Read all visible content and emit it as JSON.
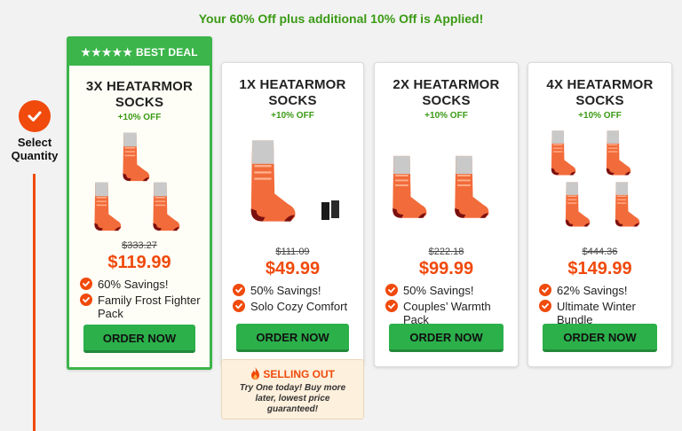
{
  "banner": "Your 60% Off plus additional 10% Off is Applied!",
  "step": {
    "label": "Select Quantity"
  },
  "colors": {
    "accent": "#f04a0c",
    "green": "#3cb54a",
    "button": "#2bb04a",
    "banner_text": "#3a9a14"
  },
  "cards": [
    {
      "badge": "BEST DEAL",
      "stars": "★★★★★",
      "title": "3X HEATARMOR SOCKS",
      "subtitle": "+10% OFF",
      "old_price": "$333.27",
      "price": "$119.99",
      "features": [
        "60% Savings!",
        "Family Frost Fighter Pack"
      ],
      "button": "ORDER NOW"
    },
    {
      "title": "1X HEATARMOR SOCKS",
      "subtitle": "+10% OFF",
      "old_price": "$111.09",
      "price": "$49.99",
      "features": [
        "50% Savings!",
        "Solo Cozy Comfort"
      ],
      "button": "ORDER NOW"
    },
    {
      "title": "2X HEATARMOR SOCKS",
      "subtitle": "+10% OFF",
      "old_price": "$222.18",
      "price": "$99.99",
      "features": [
        "50% Savings!",
        "Couples’ Warmth Pack"
      ],
      "button": "ORDER NOW"
    },
    {
      "title": "4X HEATARMOR SOCKS",
      "subtitle": "+10% OFF",
      "old_price": "$444.36",
      "price": "$149.99",
      "features": [
        "62% Savings!",
        "Ultimate Winter Bundle"
      ],
      "button": "ORDER NOW"
    }
  ],
  "selling_out": {
    "title": "SELLING OUT",
    "text": "Try One today! Buy more later, lowest price guaranteed!",
    "icon": "flame-icon"
  }
}
